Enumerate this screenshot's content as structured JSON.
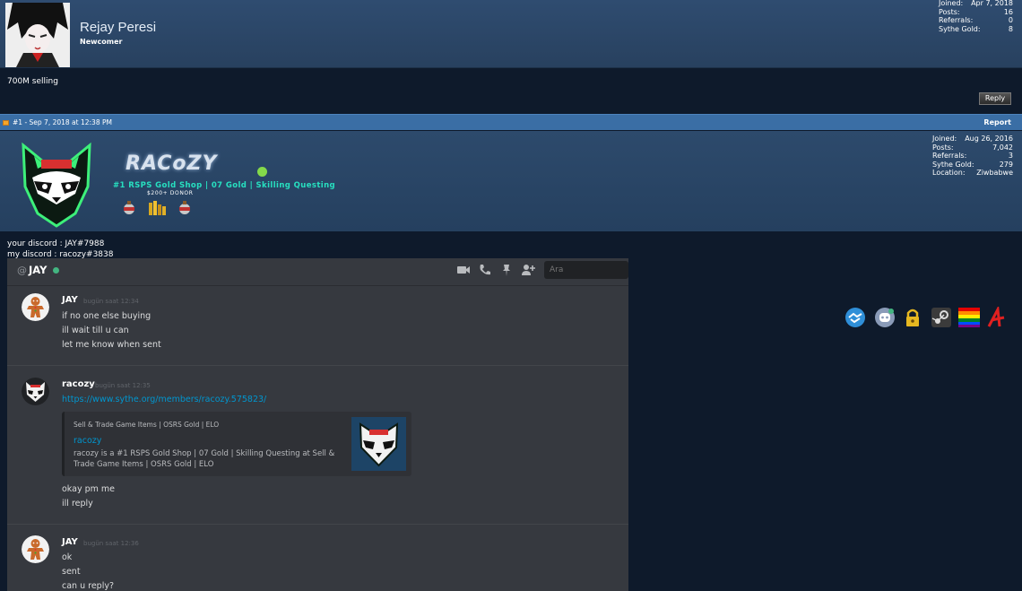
{
  "post1": {
    "username": "Rejay Peresi",
    "rank": "Newcomer",
    "stats": [
      {
        "label": "Joined:",
        "value": "Apr 7, 2018"
      },
      {
        "label": "Posts:",
        "value": "16"
      },
      {
        "label": "Referrals:",
        "value": "0"
      },
      {
        "label": "Sythe Gold:",
        "value": "8"
      }
    ],
    "message": "700M selling",
    "reply_label": "Reply"
  },
  "post2": {
    "header": "#1 - Sep 7, 2018 at 12:38 PM",
    "report_label": "Report",
    "sig_title": "RACoZY",
    "tagline": "#1 RSPS Gold Shop | 07 Gold | Skilling Questing",
    "donor_text": "$200+ DONOR",
    "stats": [
      {
        "label": "Joined:",
        "value": "Aug 26, 2016"
      },
      {
        "label": "Posts:",
        "value": "7,042"
      },
      {
        "label": "Referrals:",
        "value": "3"
      },
      {
        "label": "Sythe Gold:",
        "value": "279"
      },
      {
        "label": "Location:",
        "value": "Ziwbabwe"
      }
    ],
    "badges": [
      "handshake-badge-icon",
      "discord-badge-icon",
      "padlock-badge-icon",
      "steam-badge-icon",
      "rainbow-flag-badge-icon",
      "red-a-badge-icon"
    ],
    "message_lines": [
      "your discord : JAY#7988",
      "my discord : racozy#3838"
    ]
  },
  "discord": {
    "at_symbol": "@",
    "channel": "JAY",
    "search_placeholder": "Ara",
    "messages": [
      {
        "author": "JAY",
        "time": "bugün saat 12:34",
        "lines": [
          "if no one else buying",
          "ill wait till u can",
          "let me know when sent"
        ]
      },
      {
        "author": "racozy",
        "time": "bugün saat 12:35",
        "link": "https://www.sythe.org/members/racozy.575823/",
        "embed": {
          "provider": "Sell & Trade Game Items | OSRS Gold | ELO",
          "title": "racozy",
          "description": "racozy is a #1 RSPS Gold Shop | 07 Gold | Skilling Questing at Sell & Trade Game Items | OSRS Gold | ELO"
        },
        "lines": [
          "okay pm me",
          "ill reply"
        ]
      },
      {
        "author": "JAY",
        "time": "bugün saat 12:36",
        "lines": [
          "ok",
          "sent",
          "can u reply?"
        ]
      }
    ]
  }
}
